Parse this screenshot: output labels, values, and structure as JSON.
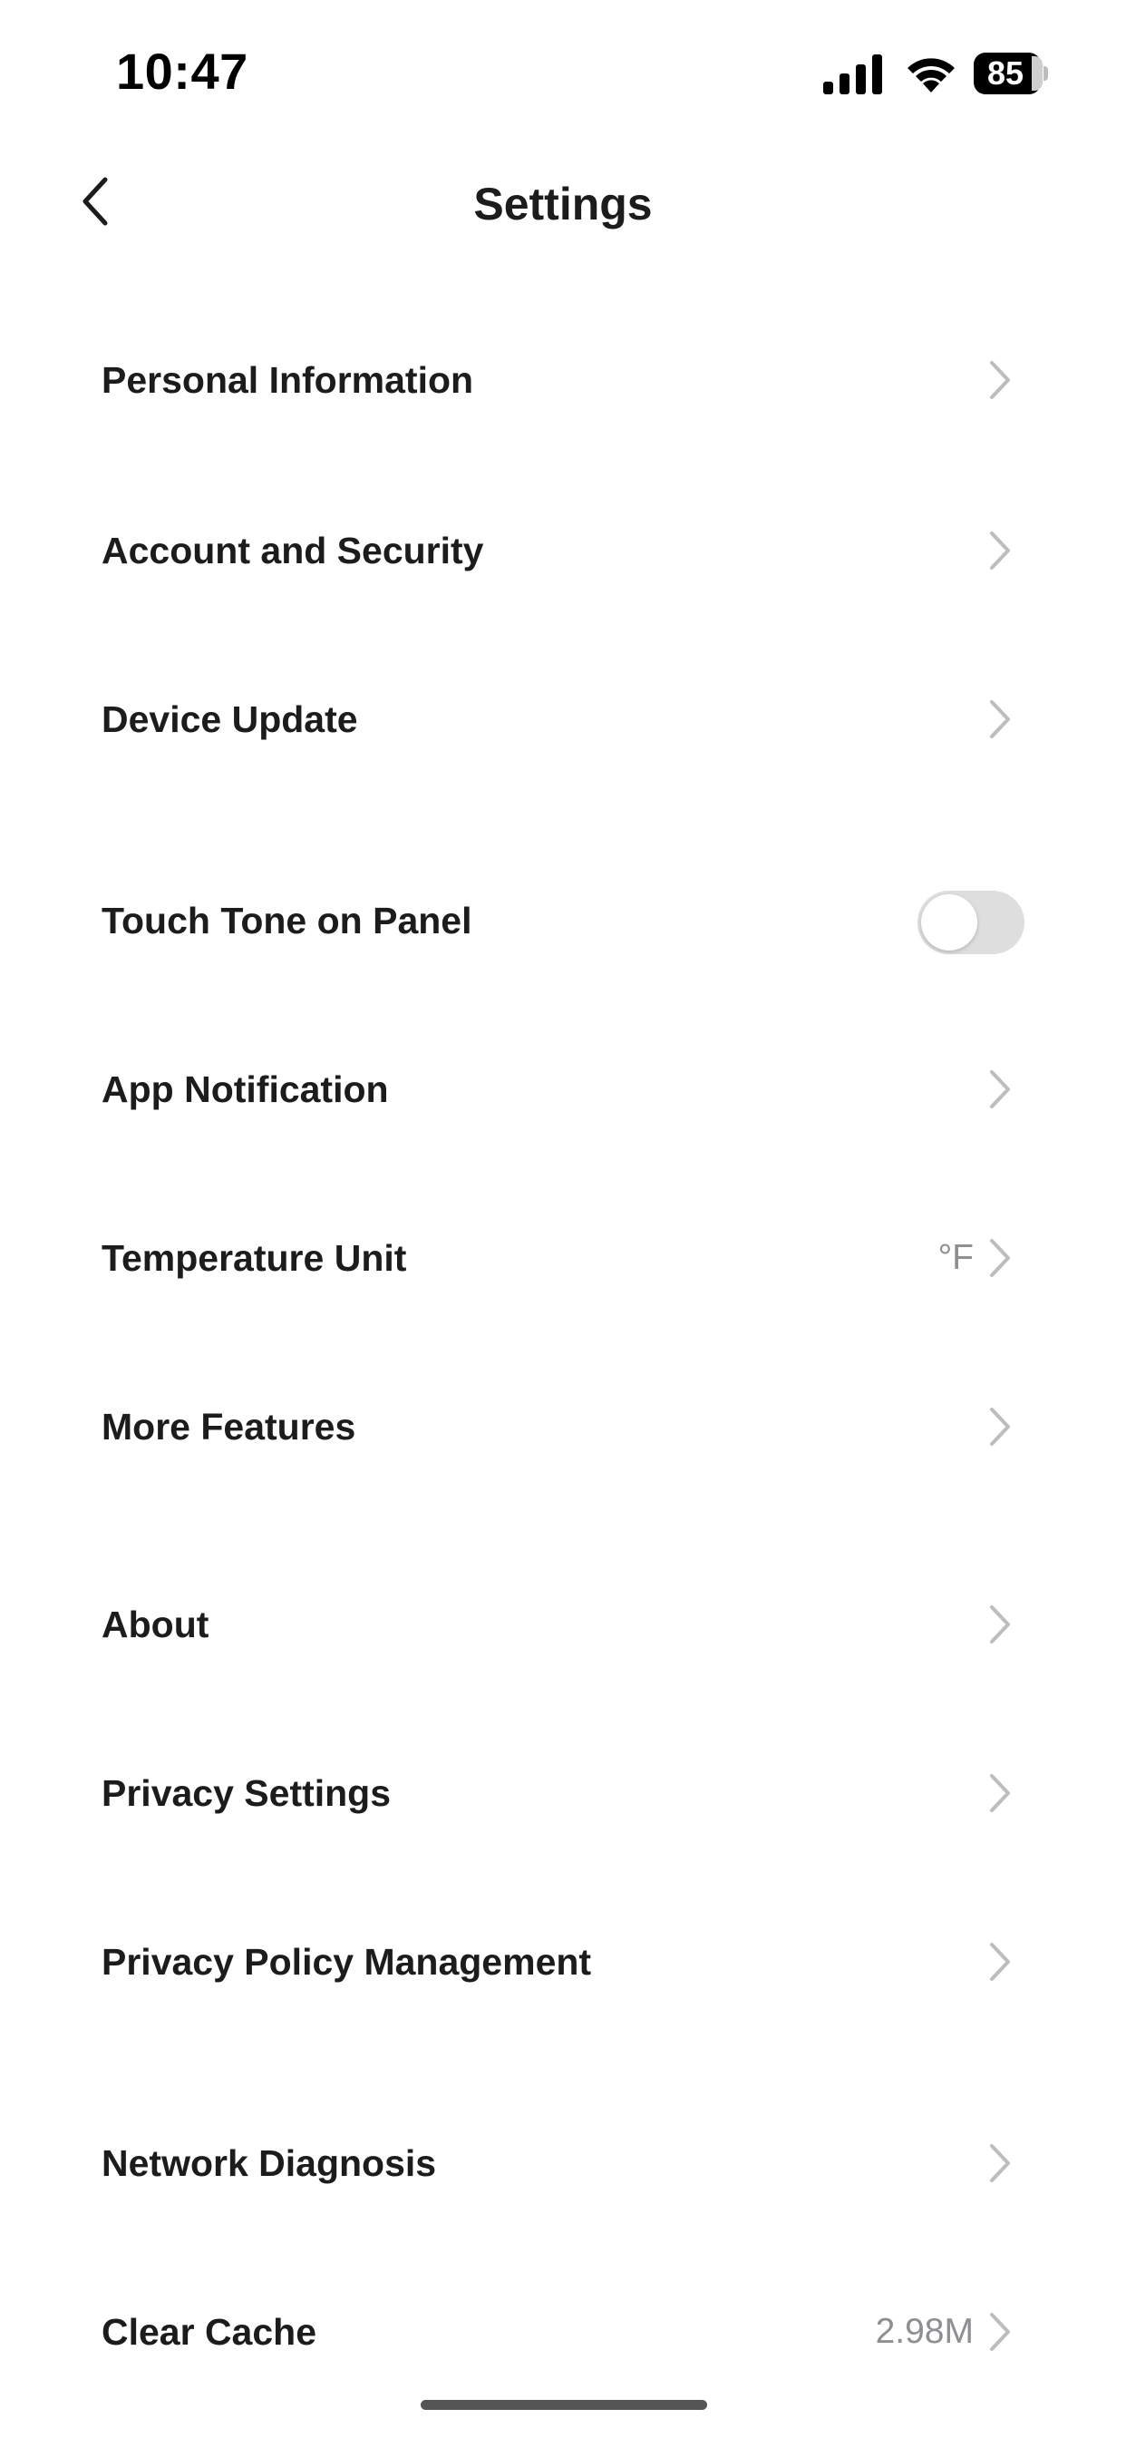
{
  "status_bar": {
    "time": "10:47",
    "battery": "85",
    "icons": [
      "cellular-signal-icon",
      "wifi-icon",
      "battery-icon"
    ]
  },
  "nav": {
    "title": "Settings",
    "back_icon": "chevron-left-icon"
  },
  "settings": {
    "personal_information": {
      "label": "Personal Information"
    },
    "account_security": {
      "label": "Account and Security"
    },
    "device_update": {
      "label": "Device Update"
    },
    "touch_tone": {
      "label": "Touch Tone on Panel",
      "toggle_on": false
    },
    "app_notification": {
      "label": "App Notification"
    },
    "temperature_unit": {
      "label": "Temperature Unit",
      "value": "°F"
    },
    "more_features": {
      "label": "More Features"
    },
    "about": {
      "label": "About"
    },
    "privacy_settings": {
      "label": "Privacy Settings"
    },
    "privacy_policy": {
      "label": "Privacy Policy Management"
    },
    "network_diagnosis": {
      "label": "Network Diagnosis"
    },
    "clear_cache": {
      "label": "Clear Cache",
      "value": "2.98M"
    }
  },
  "colors": {
    "text": "#1c1c1e",
    "secondary_text": "#8e8e93",
    "chevron": "#bdbdbd",
    "toggle_off_track": "#dedede",
    "background": "#ffffff"
  }
}
